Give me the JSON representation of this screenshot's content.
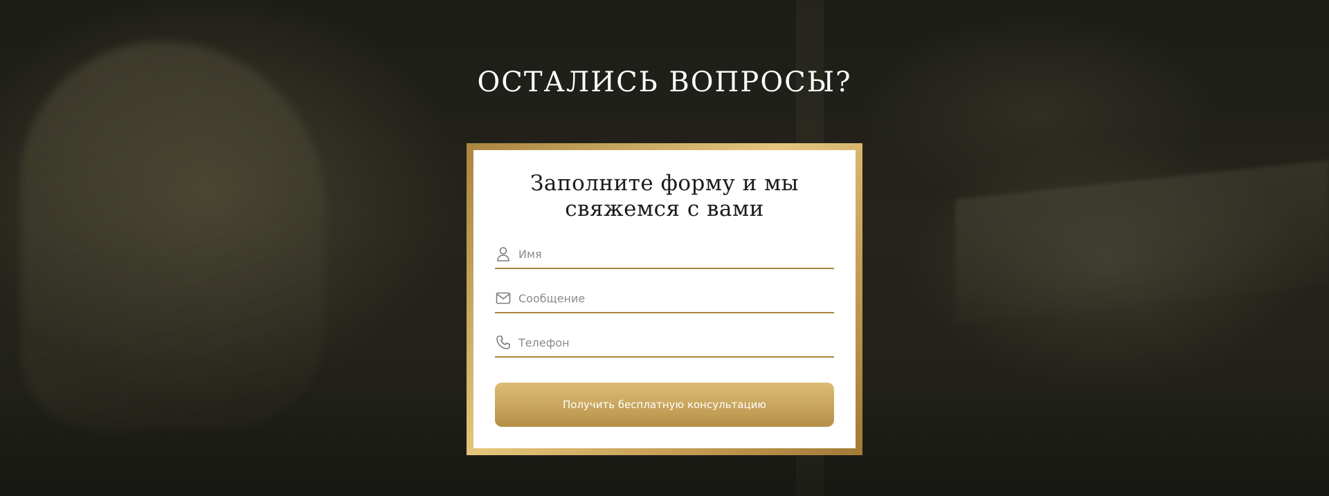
{
  "section": {
    "heading": "ОСТАЛИСЬ ВОПРОСЫ?"
  },
  "form": {
    "title_line1": "Заполните форму и мы",
    "title_line2": "свяжемся с вами",
    "fields": {
      "name": {
        "placeholder": "Имя",
        "value": "",
        "icon": "user-icon"
      },
      "message": {
        "placeholder": "Сообщение",
        "value": "",
        "icon": "envelope-icon"
      },
      "phone": {
        "placeholder": "Телефон",
        "value": "",
        "icon": "phone-icon"
      }
    },
    "submit_label": "Получить бесплатную консультацию"
  },
  "colors": {
    "accent_gold": "#c8a45c",
    "underline": "#a8843c",
    "background": "#1f1f19"
  }
}
